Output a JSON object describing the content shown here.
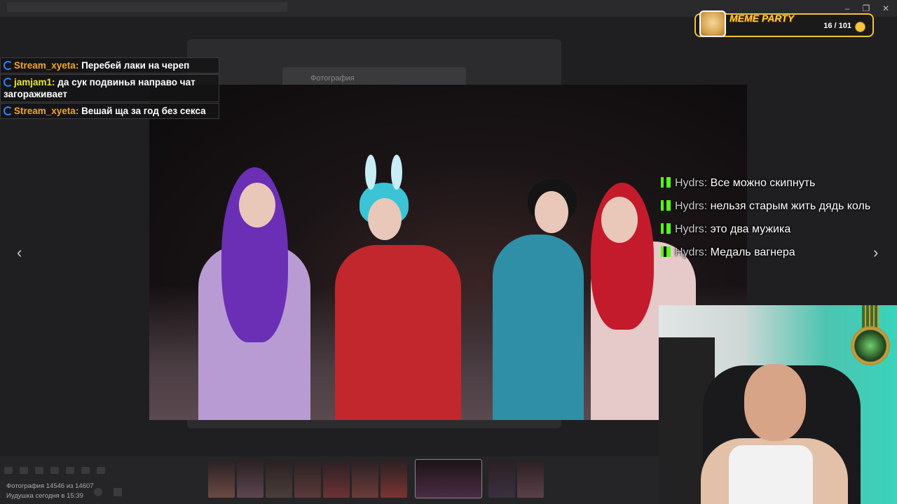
{
  "viewer": {
    "prev_label": "‹",
    "next_label": "›",
    "underlay_header": "Фотография",
    "photo_count": "Фотография 14546 из 14607",
    "photo_info": "Иудушка  сегодня в 15:39",
    "window_minimize": "–",
    "window_restore": "❐",
    "window_close": "✕"
  },
  "chat_left": [
    {
      "user": "Stream_xyeta",
      "user_color": "#f5a623",
      "text": "Перебей лаки на череп"
    },
    {
      "user": "jamjam1",
      "user_color": "#e6e63a",
      "text": "да сук подвинья направо чат загораживает"
    },
    {
      "user": "Stream_xyeta",
      "user_color": "#f5a623",
      "text": "Вешай ща за год без секса"
    }
  ],
  "chat_right": [
    {
      "user": "Hydrs",
      "text": "Все можно скипнуть"
    },
    {
      "user": "Hydrs",
      "text": "нельзя старым жить дядь коль"
    },
    {
      "user": "Hydrs",
      "text": "это два мужика"
    },
    {
      "user": "Hydrs",
      "text": "Медаль вагнера"
    }
  ],
  "meme_party": {
    "title": "MEME PARTY",
    "count": "16 / 101"
  },
  "colors": {
    "kick_green": "#53fc18",
    "accent_gold": "#f0c23a"
  },
  "thumbnails": [
    {
      "color": "#6a4a44"
    },
    {
      "color": "#5c4650"
    },
    {
      "color": "#4a3e3a"
    },
    {
      "color": "#5a3a38"
    },
    {
      "color": "#6b3236"
    },
    {
      "color": "#6a3c3a"
    },
    {
      "color": "#7a3434"
    },
    {
      "color": "#4a2c44"
    },
    {
      "color": "#3a3040"
    },
    {
      "color": "#5a4048"
    }
  ]
}
